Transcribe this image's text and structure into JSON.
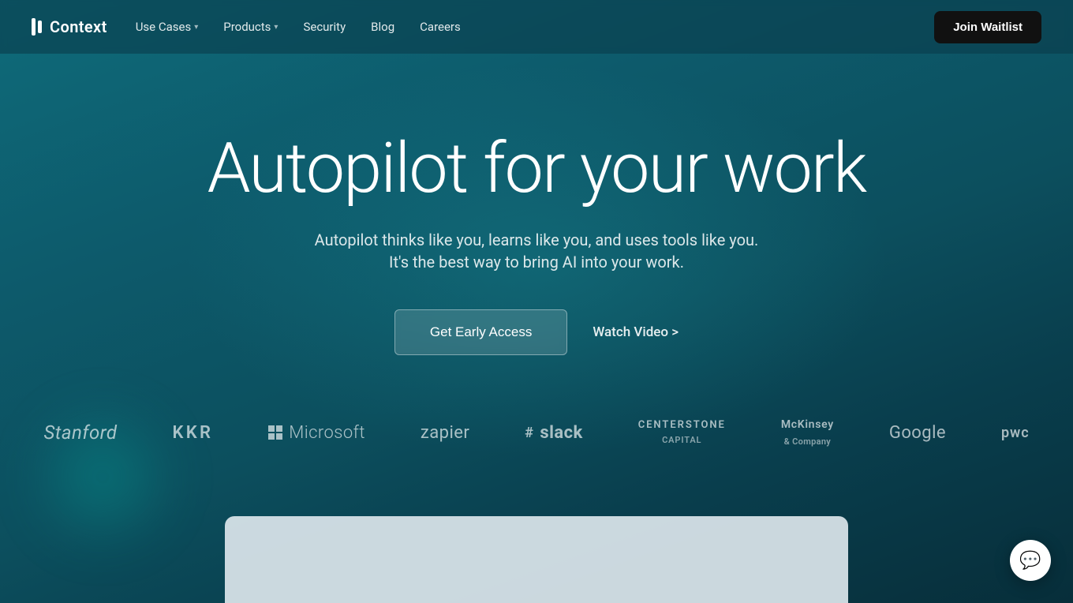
{
  "logo": {
    "text": "Context"
  },
  "nav": {
    "links": [
      {
        "label": "Use Cases",
        "hasChevron": true
      },
      {
        "label": "Products",
        "hasChevron": true
      },
      {
        "label": "Security",
        "hasChevron": false
      },
      {
        "label": "Blog",
        "hasChevron": false
      },
      {
        "label": "Careers",
        "hasChevron": false
      }
    ],
    "cta": "Join Waitlist"
  },
  "hero": {
    "title": "Autopilot for your work",
    "subtitle_line1": "Autopilot thinks like you, learns like you, and uses tools like you.",
    "subtitle_line2": "It's the best way to bring AI into your work.",
    "cta_primary": "Get Early Access",
    "cta_secondary": "Watch Video >"
  },
  "logos": [
    {
      "name": "stanford",
      "text": "Stanford",
      "type": "text-italic"
    },
    {
      "name": "kkr",
      "text": "KKR",
      "type": "text-spaced"
    },
    {
      "name": "microsoft",
      "text": "Microsoft",
      "type": "ms-grid"
    },
    {
      "name": "zapier",
      "text": "zapier",
      "type": "text"
    },
    {
      "name": "slack",
      "text": "slack",
      "type": "slack"
    },
    {
      "name": "centerstone",
      "type": "centerstone",
      "line1": "CENTERSTONE",
      "line2": "CAPITAL"
    },
    {
      "name": "mckinsey",
      "type": "mckinsey",
      "line1": "McKinsey",
      "line2": "& Company"
    },
    {
      "name": "google",
      "text": "Google",
      "type": "text"
    },
    {
      "name": "pwc",
      "text": "pwc",
      "type": "text"
    }
  ],
  "chat": {
    "icon": "💬"
  }
}
